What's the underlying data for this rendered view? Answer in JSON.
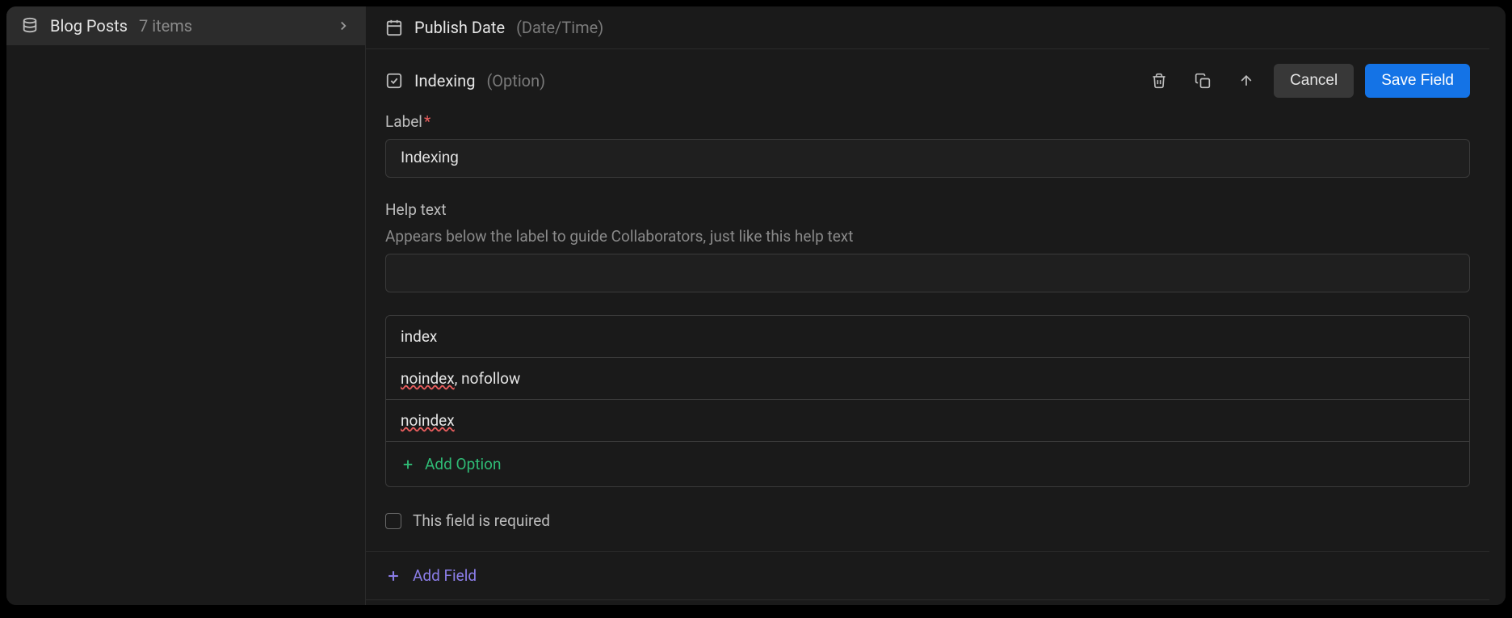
{
  "sidebar": {
    "collection": {
      "name": "Blog Posts",
      "count": "7 items"
    }
  },
  "fields": {
    "publish_date": {
      "name": "Publish Date",
      "type": "(Date/Time)"
    },
    "indexing": {
      "name": "Indexing",
      "type": "(Option)"
    }
  },
  "editor": {
    "label_label": "Label",
    "label_value": "Indexing",
    "help_label": "Help text",
    "help_desc": "Appears below the label to guide Collaborators, just like this help text",
    "help_value": "",
    "options": [
      {
        "text": "index",
        "spell": false
      },
      {
        "text_pre": "noindex",
        "text_post": ", nofollow",
        "spell": true
      },
      {
        "text_pre": "noindex",
        "text_post": "",
        "spell": true
      }
    ],
    "add_option": "Add Option",
    "required_label": "This field is required",
    "required_checked": false
  },
  "actions": {
    "cancel": "Cancel",
    "save": "Save Field",
    "add_field": "Add Field"
  }
}
